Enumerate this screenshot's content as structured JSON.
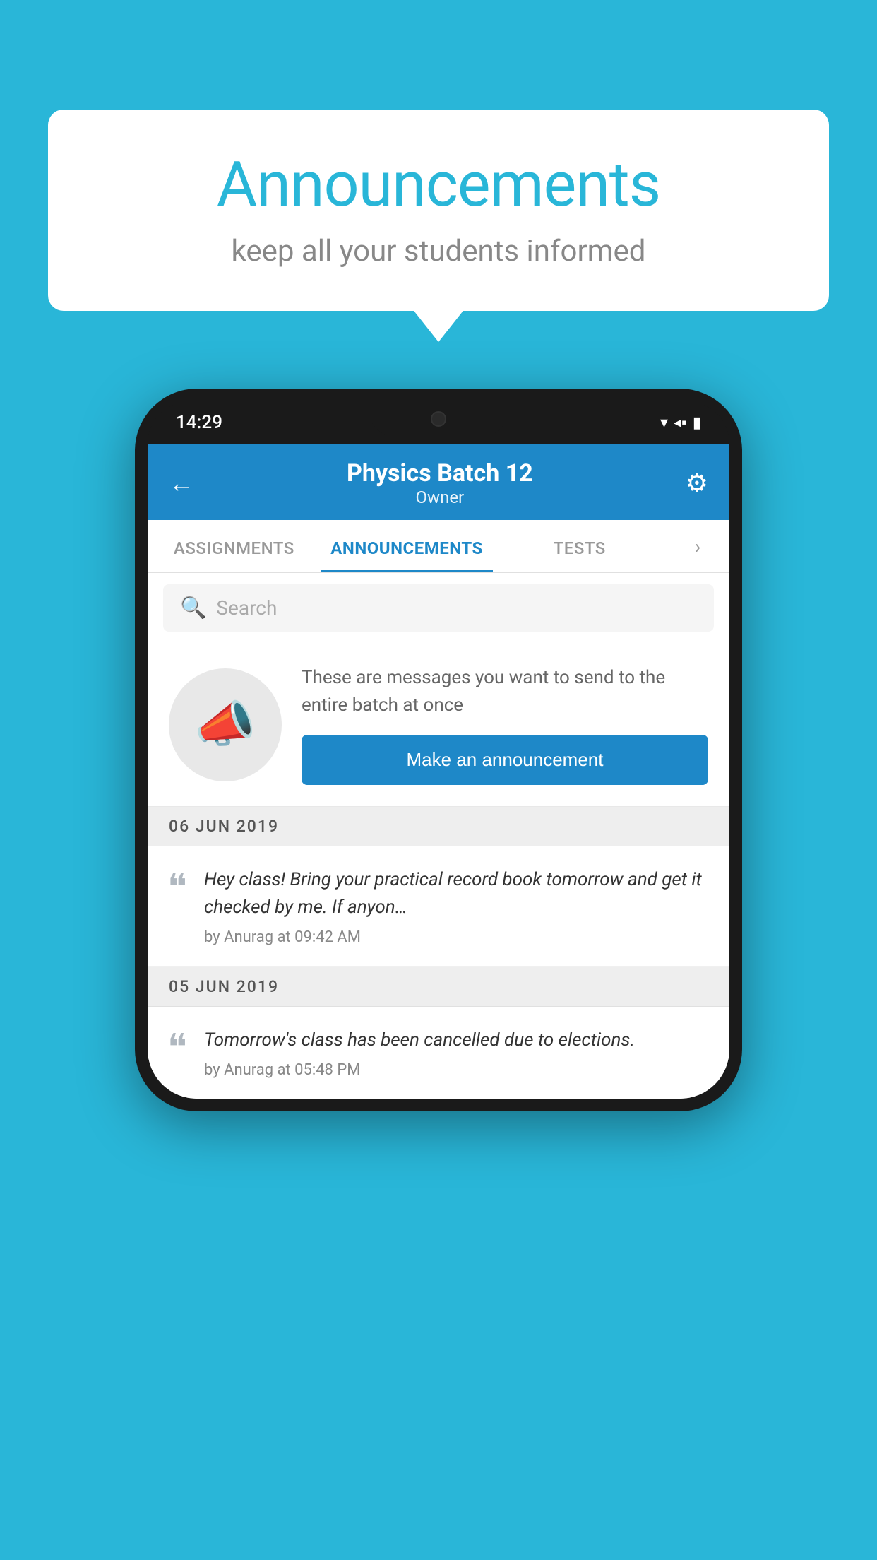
{
  "background_color": "#29b6d8",
  "speech_bubble": {
    "title": "Announcements",
    "subtitle": "keep all your students informed"
  },
  "phone": {
    "status_bar": {
      "time": "14:29",
      "wifi": "▾",
      "signal": "▲",
      "battery": "▮"
    },
    "header": {
      "title": "Physics Batch 12",
      "subtitle": "Owner",
      "back_label": "←",
      "gear_label": "⚙"
    },
    "tabs": [
      {
        "label": "ASSIGNMENTS",
        "active": false
      },
      {
        "label": "ANNOUNCEMENTS",
        "active": true
      },
      {
        "label": "TESTS",
        "active": false
      }
    ],
    "search": {
      "placeholder": "Search",
      "icon": "🔍"
    },
    "promo": {
      "description": "These are messages you want to send to the entire batch at once",
      "button_label": "Make an announcement"
    },
    "announcements": [
      {
        "date": "06  JUN  2019",
        "message": "Hey class! Bring your practical record book tomorrow and get it checked by me. If anyon…",
        "meta": "by Anurag at 09:42 AM"
      },
      {
        "date": "05  JUN  2019",
        "message": "Tomorrow's class has been cancelled due to elections.",
        "meta": "by Anurag at 05:48 PM"
      }
    ]
  }
}
